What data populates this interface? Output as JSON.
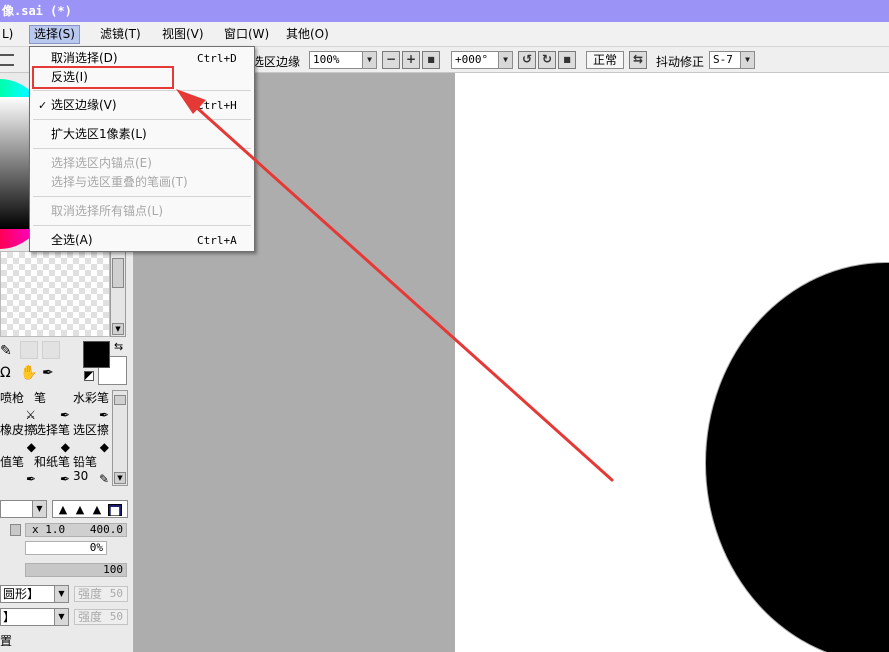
{
  "window": {
    "title": "像.sai (*)"
  },
  "menubar": {
    "items": [
      {
        "label": "L)"
      },
      {
        "label": "选择(S)"
      },
      {
        "label": "滤镜(T)"
      },
      {
        "label": "视图(V)"
      },
      {
        "label": "窗口(W)"
      },
      {
        "label": "其他(O)"
      }
    ]
  },
  "toolbar": {
    "selection_edge_label": "选区边缘",
    "zoom_value": "100%",
    "zoom_out": "−",
    "zoom_in": "+",
    "zoom_reset": "■",
    "rotation_value": "+000°",
    "rotate_ccw": "↺",
    "rotate_cw": "↻",
    "rotate_reset": "■",
    "blend_mode": "正常",
    "flip_icon": "⇆",
    "stabilizer_label": "抖动修正",
    "stabilizer_value": "S-7"
  },
  "select_menu": {
    "items": [
      {
        "label": "取消选择(D)",
        "shortcut": "Ctrl+D",
        "enabled": true,
        "checked": false
      },
      {
        "label": "反选(I)",
        "shortcut": "",
        "enabled": true,
        "checked": false,
        "highlighted": true
      },
      {
        "label": "选区边缘(V)",
        "shortcut": "Ctrl+H",
        "enabled": true,
        "checked": true
      },
      {
        "label": "扩大选区1像素(L)",
        "shortcut": "",
        "enabled": true,
        "checked": false
      },
      {
        "label": "选择选区内锚点(E)",
        "shortcut": "",
        "enabled": false,
        "checked": false
      },
      {
        "label": "选择与选区重叠的笔画(T)",
        "shortcut": "",
        "enabled": false,
        "checked": false
      },
      {
        "label": "取消选择所有锚点(L)",
        "shortcut": "",
        "enabled": false,
        "checked": false
      },
      {
        "label": "全选(A)",
        "shortcut": "Ctrl+A",
        "enabled": true,
        "checked": false
      }
    ],
    "check_mark": "✓"
  },
  "left_panel": {
    "tools_row_icons": [
      "✎",
      "Ω",
      "✋",
      "✒"
    ],
    "swap_icon": "⇆",
    "brushes": [
      {
        "label": "喷枪",
        "glyph": "⚔"
      },
      {
        "label": "笔",
        "glyph": "✒"
      },
      {
        "label": "水彩笔",
        "glyph": "✒"
      },
      {
        "label": "橡皮擦",
        "glyph": "◆"
      },
      {
        "label": "选择笔",
        "glyph": "◆"
      },
      {
        "label": "选区擦",
        "glyph": "◆"
      },
      {
        "label": "值笔",
        "glyph": "✒"
      },
      {
        "label": "和纸笔",
        "glyph": "✒"
      },
      {
        "label": "铅笔30",
        "glyph": "✎"
      }
    ],
    "brush_shapes": [
      "▲",
      "▲",
      "▲",
      "■"
    ],
    "size_multiplier": "x 1.0",
    "size_value": "400.0",
    "min_size_value": "0%",
    "density_value": "100",
    "shape_combo": "圆形】",
    "texture_combo": "】",
    "strength_label": "强度",
    "strength_value": "50",
    "bottom_label": "置"
  },
  "colors": {
    "title_bar": "#9b93f5",
    "highlight_red": "#e53935",
    "foreground": "#000000",
    "background": "#ffffff"
  }
}
